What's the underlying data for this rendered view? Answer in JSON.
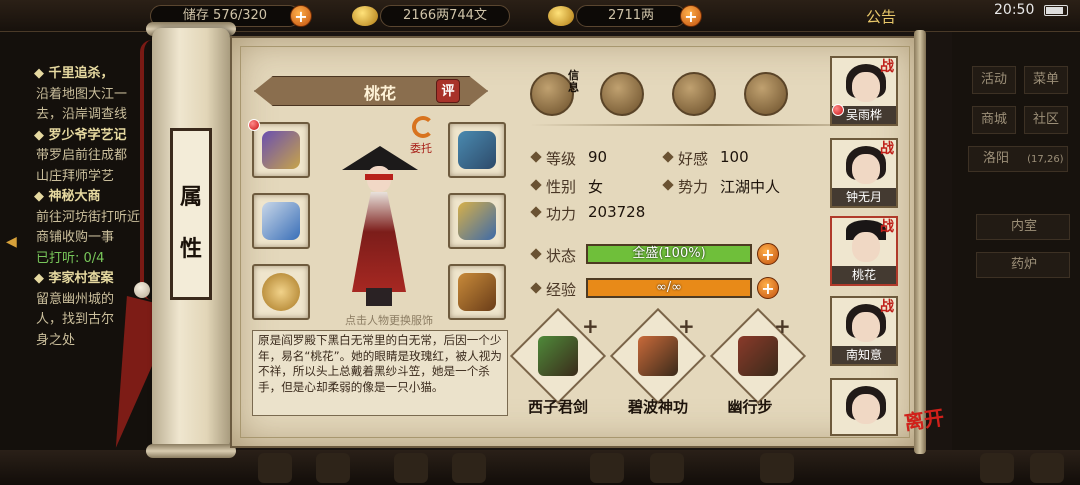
{
  "hud": {
    "storage": "储存 576/320",
    "money": "2166两744文",
    "gold": "2711两",
    "notice": "公告",
    "time": "20:50"
  },
  "quests": {
    "lines": [
      {
        "type": "title",
        "text": "◆ 千里追杀，"
      },
      {
        "type": "text",
        "text": "沿着地图大江一"
      },
      {
        "type": "text",
        "text": "去，沿岸调查线"
      },
      {
        "type": "title",
        "text": "◆ 罗少爷学艺记"
      },
      {
        "type": "text",
        "text": "带罗启前往成都"
      },
      {
        "type": "text",
        "text": "山庄拜师学艺"
      },
      {
        "type": "title",
        "text": "◆ 神秘大商"
      },
      {
        "type": "text",
        "text": "前往河坊街打听近"
      },
      {
        "type": "text",
        "text": "商铺收购一事"
      },
      {
        "type": "green",
        "text": "已打听: 0/4"
      },
      {
        "type": "title",
        "text": "◆ 李家村查案"
      },
      {
        "type": "text",
        "text": "留意幽州城的"
      },
      {
        "type": "text",
        "text": "人，找到古尔"
      },
      {
        "type": "text",
        "text": "身之处"
      }
    ]
  },
  "right_menu": {
    "activity": "活动",
    "menu": "菜单",
    "shop": "商城",
    "community": "社区",
    "location": "洛阳",
    "coords": "(17,26)",
    "inner_room": "内室",
    "furnace": "药炉"
  },
  "scroll_label": [
    "属",
    "性"
  ],
  "character": {
    "name": "桃花",
    "rate_label": "评",
    "delegate_label": "委托",
    "hint": "点击人物更换服饰",
    "bio": "原是阎罗殿下黑白无常里的白无常，后因一个少年，易名“桃花”。她的眼睛是玫瑰红，被人视为不祥，所以头上总戴着黑纱斗笠，她是一个杀手，但是心却柔弱的像是一只小猫。"
  },
  "functions": [
    {
      "name": "info-icon",
      "tag": "信息"
    },
    {
      "name": "map-scroll-icon"
    },
    {
      "name": "bagua-icon"
    },
    {
      "name": "meridian-figure-icon"
    }
  ],
  "stats": {
    "level_label": "等级",
    "level": "90",
    "favor_label": "好感",
    "favor": "100",
    "gender_label": "性别",
    "gender": "女",
    "faction_label": "势力",
    "faction": "江湖中人",
    "power_label": "功力",
    "power": "203728",
    "status_label": "状态",
    "status_text": "全盛(100%)",
    "status_pct": 100,
    "exp_label": "经验",
    "exp_text": "∞/∞",
    "exp_pct": 100
  },
  "skills": [
    {
      "name": "西子君剑",
      "color": "#4f8a3a"
    },
    {
      "name": "碧波神功",
      "color": "#c96a3a"
    },
    {
      "name": "幽行步",
      "color": "#8a3a2a"
    }
  ],
  "roster": [
    {
      "name": "吴雨桦",
      "battle": "战"
    },
    {
      "name": "钟无月",
      "battle": "战"
    },
    {
      "name": "桃花",
      "battle": "战"
    },
    {
      "name": "南知意",
      "battle": "战"
    },
    {
      "name": ""
    }
  ],
  "leave_label": "离开",
  "colors": {
    "status_bar": "#6fbf3a",
    "exp_bar": "#e88a18",
    "accent_red": "#c0201a"
  }
}
